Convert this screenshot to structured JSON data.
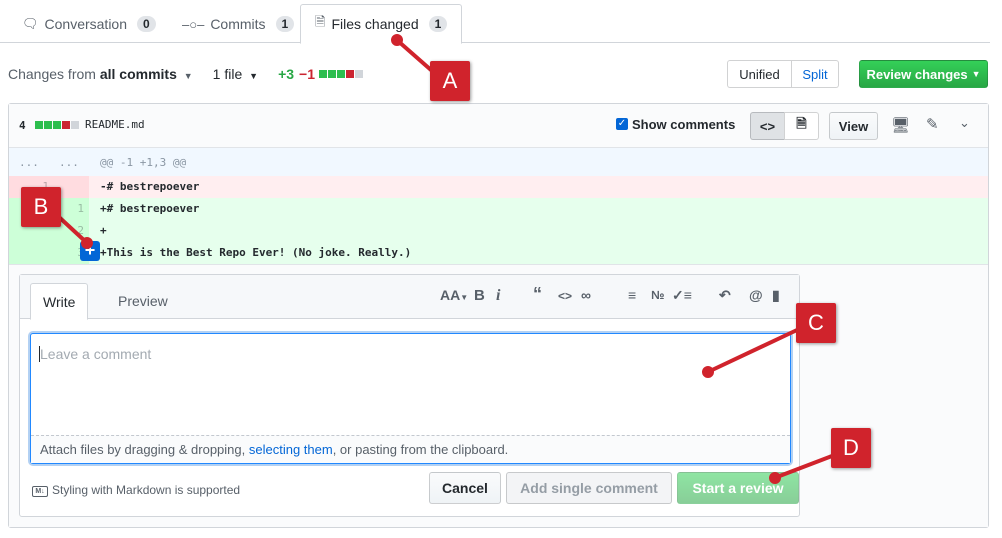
{
  "tabs": [
    {
      "label": "Conversation",
      "count": "0",
      "icon": "comment-icon"
    },
    {
      "label": "Commits",
      "count": "1",
      "icon": "commit-icon"
    },
    {
      "label": "Files changed",
      "count": "1",
      "icon": "file-diff-icon"
    }
  ],
  "toolbar": {
    "changes_prefix": "Changes from",
    "changes_value": "all commits",
    "files": "1 file",
    "additions": "+3",
    "deletions": "−1",
    "unified": "Unified",
    "split": "Split",
    "review": "Review changes"
  },
  "file": {
    "changes": "4",
    "name": "README.md",
    "show_comments": "Show comments",
    "view": "View"
  },
  "diff": {
    "hunk_left": "...",
    "hunk_right": "...",
    "hunk_header": "@@ -1 +1,3 @@",
    "lines": [
      {
        "old": "1",
        "new": "",
        "code": "-# bestrepoever",
        "type": "del"
      },
      {
        "old": "",
        "new": "1",
        "code": "+# bestrepoever",
        "type": "add"
      },
      {
        "old": "",
        "new": "2",
        "code": "+",
        "type": "add"
      },
      {
        "old": "",
        "new": "3",
        "code": "+This is the Best Repo Ever! (No joke. Really.)",
        "type": "add"
      }
    ]
  },
  "comment_form": {
    "write": "Write",
    "preview": "Preview",
    "placeholder": "Leave a comment",
    "attach_prefix": "Attach files by dragging & dropping,",
    "attach_link": "selecting them",
    "attach_suffix": ", or pasting from the clipboard.",
    "markdown_note": "Styling with Markdown is supported",
    "cancel": "Cancel",
    "add_single": "Add single comment",
    "start_review": "Start a review",
    "header_label": "AA"
  },
  "callouts": [
    "A",
    "B",
    "C",
    "D"
  ],
  "colors": {
    "callout": "#d0232c",
    "add_bg": "#e6ffed",
    "del_bg": "#ffeef0",
    "green": "#28a745",
    "red": "#cb2431",
    "link": "#0366d6"
  }
}
